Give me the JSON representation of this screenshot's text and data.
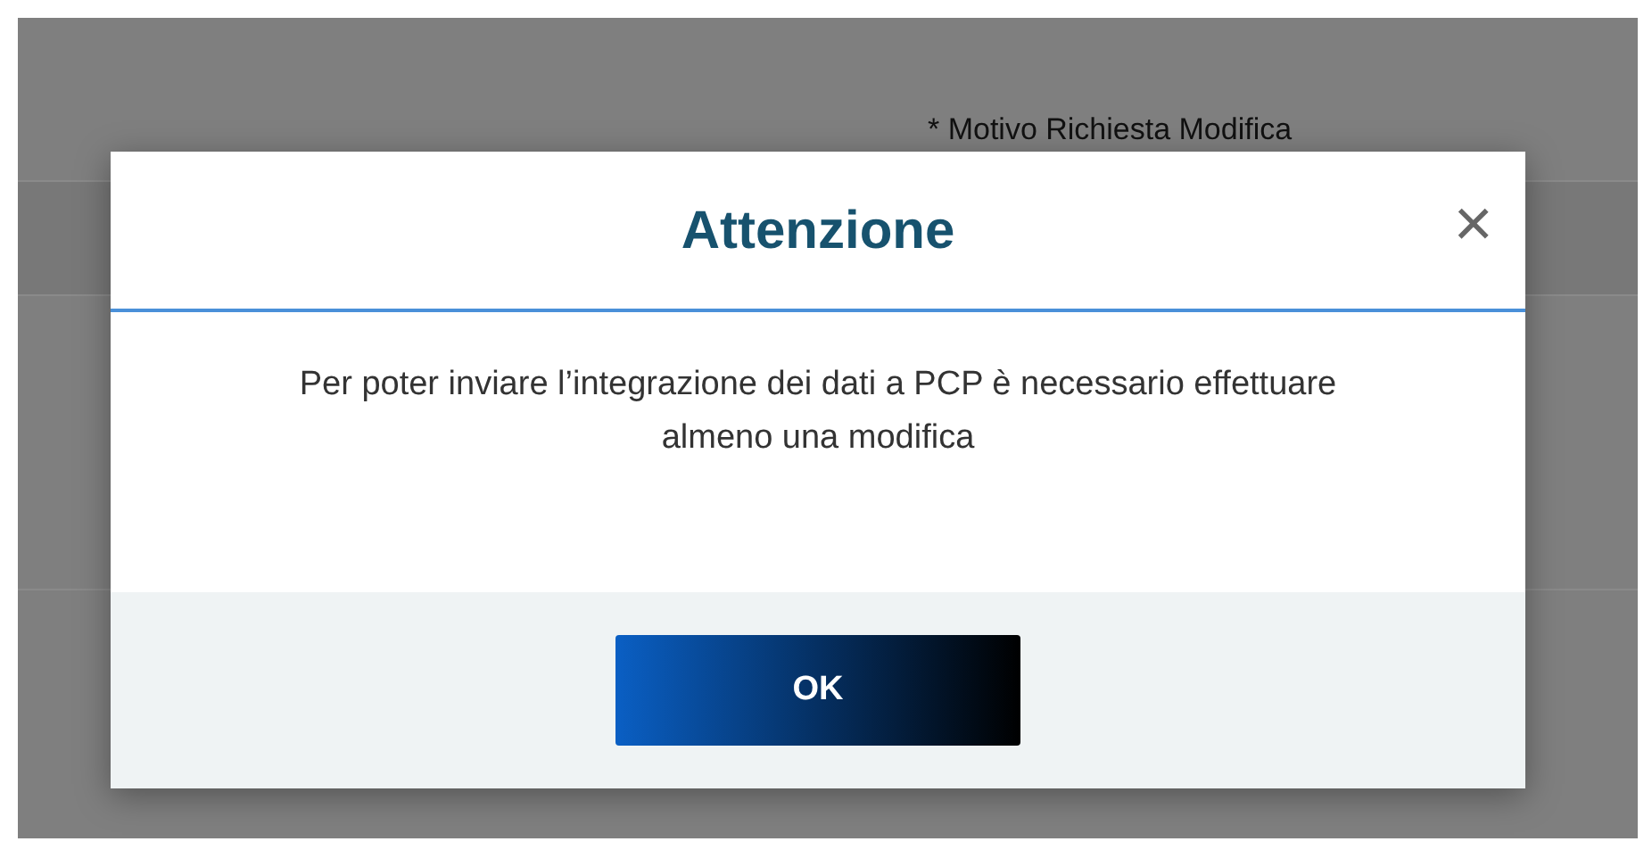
{
  "background_page": {
    "field_label": "* Motivo Richiesta Modifica"
  },
  "dialog": {
    "title": "Attenzione",
    "close": "×",
    "message": "Per poter inviare l’integrazione dei dati a PCP è necessario effettuare almeno una modifica",
    "buttons": [
      "OK"
    ]
  }
}
